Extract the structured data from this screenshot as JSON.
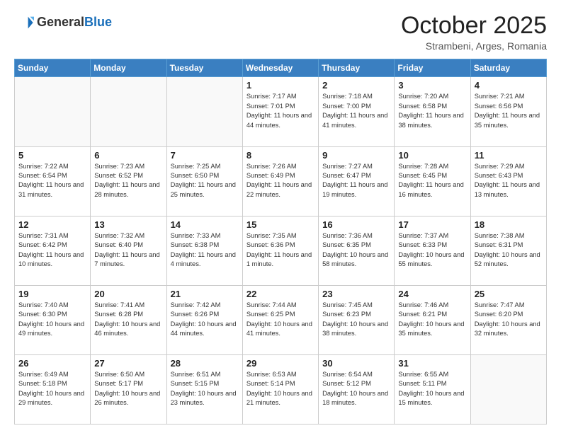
{
  "header": {
    "logo_line1": "General",
    "logo_line2": "Blue",
    "month": "October 2025",
    "location": "Strambeni, Arges, Romania"
  },
  "days_of_week": [
    "Sunday",
    "Monday",
    "Tuesday",
    "Wednesday",
    "Thursday",
    "Friday",
    "Saturday"
  ],
  "weeks": [
    [
      {
        "day": "",
        "info": ""
      },
      {
        "day": "",
        "info": ""
      },
      {
        "day": "",
        "info": ""
      },
      {
        "day": "1",
        "info": "Sunrise: 7:17 AM\nSunset: 7:01 PM\nDaylight: 11 hours and 44 minutes."
      },
      {
        "day": "2",
        "info": "Sunrise: 7:18 AM\nSunset: 7:00 PM\nDaylight: 11 hours and 41 minutes."
      },
      {
        "day": "3",
        "info": "Sunrise: 7:20 AM\nSunset: 6:58 PM\nDaylight: 11 hours and 38 minutes."
      },
      {
        "day": "4",
        "info": "Sunrise: 7:21 AM\nSunset: 6:56 PM\nDaylight: 11 hours and 35 minutes."
      }
    ],
    [
      {
        "day": "5",
        "info": "Sunrise: 7:22 AM\nSunset: 6:54 PM\nDaylight: 11 hours and 31 minutes."
      },
      {
        "day": "6",
        "info": "Sunrise: 7:23 AM\nSunset: 6:52 PM\nDaylight: 11 hours and 28 minutes."
      },
      {
        "day": "7",
        "info": "Sunrise: 7:25 AM\nSunset: 6:50 PM\nDaylight: 11 hours and 25 minutes."
      },
      {
        "day": "8",
        "info": "Sunrise: 7:26 AM\nSunset: 6:49 PM\nDaylight: 11 hours and 22 minutes."
      },
      {
        "day": "9",
        "info": "Sunrise: 7:27 AM\nSunset: 6:47 PM\nDaylight: 11 hours and 19 minutes."
      },
      {
        "day": "10",
        "info": "Sunrise: 7:28 AM\nSunset: 6:45 PM\nDaylight: 11 hours and 16 minutes."
      },
      {
        "day": "11",
        "info": "Sunrise: 7:29 AM\nSunset: 6:43 PM\nDaylight: 11 hours and 13 minutes."
      }
    ],
    [
      {
        "day": "12",
        "info": "Sunrise: 7:31 AM\nSunset: 6:42 PM\nDaylight: 11 hours and 10 minutes."
      },
      {
        "day": "13",
        "info": "Sunrise: 7:32 AM\nSunset: 6:40 PM\nDaylight: 11 hours and 7 minutes."
      },
      {
        "day": "14",
        "info": "Sunrise: 7:33 AM\nSunset: 6:38 PM\nDaylight: 11 hours and 4 minutes."
      },
      {
        "day": "15",
        "info": "Sunrise: 7:35 AM\nSunset: 6:36 PM\nDaylight: 11 hours and 1 minute."
      },
      {
        "day": "16",
        "info": "Sunrise: 7:36 AM\nSunset: 6:35 PM\nDaylight: 10 hours and 58 minutes."
      },
      {
        "day": "17",
        "info": "Sunrise: 7:37 AM\nSunset: 6:33 PM\nDaylight: 10 hours and 55 minutes."
      },
      {
        "day": "18",
        "info": "Sunrise: 7:38 AM\nSunset: 6:31 PM\nDaylight: 10 hours and 52 minutes."
      }
    ],
    [
      {
        "day": "19",
        "info": "Sunrise: 7:40 AM\nSunset: 6:30 PM\nDaylight: 10 hours and 49 minutes."
      },
      {
        "day": "20",
        "info": "Sunrise: 7:41 AM\nSunset: 6:28 PM\nDaylight: 10 hours and 46 minutes."
      },
      {
        "day": "21",
        "info": "Sunrise: 7:42 AM\nSunset: 6:26 PM\nDaylight: 10 hours and 44 minutes."
      },
      {
        "day": "22",
        "info": "Sunrise: 7:44 AM\nSunset: 6:25 PM\nDaylight: 10 hours and 41 minutes."
      },
      {
        "day": "23",
        "info": "Sunrise: 7:45 AM\nSunset: 6:23 PM\nDaylight: 10 hours and 38 minutes."
      },
      {
        "day": "24",
        "info": "Sunrise: 7:46 AM\nSunset: 6:21 PM\nDaylight: 10 hours and 35 minutes."
      },
      {
        "day": "25",
        "info": "Sunrise: 7:47 AM\nSunset: 6:20 PM\nDaylight: 10 hours and 32 minutes."
      }
    ],
    [
      {
        "day": "26",
        "info": "Sunrise: 6:49 AM\nSunset: 5:18 PM\nDaylight: 10 hours and 29 minutes."
      },
      {
        "day": "27",
        "info": "Sunrise: 6:50 AM\nSunset: 5:17 PM\nDaylight: 10 hours and 26 minutes."
      },
      {
        "day": "28",
        "info": "Sunrise: 6:51 AM\nSunset: 5:15 PM\nDaylight: 10 hours and 23 minutes."
      },
      {
        "day": "29",
        "info": "Sunrise: 6:53 AM\nSunset: 5:14 PM\nDaylight: 10 hours and 21 minutes."
      },
      {
        "day": "30",
        "info": "Sunrise: 6:54 AM\nSunset: 5:12 PM\nDaylight: 10 hours and 18 minutes."
      },
      {
        "day": "31",
        "info": "Sunrise: 6:55 AM\nSunset: 5:11 PM\nDaylight: 10 hours and 15 minutes."
      },
      {
        "day": "",
        "info": ""
      }
    ]
  ]
}
